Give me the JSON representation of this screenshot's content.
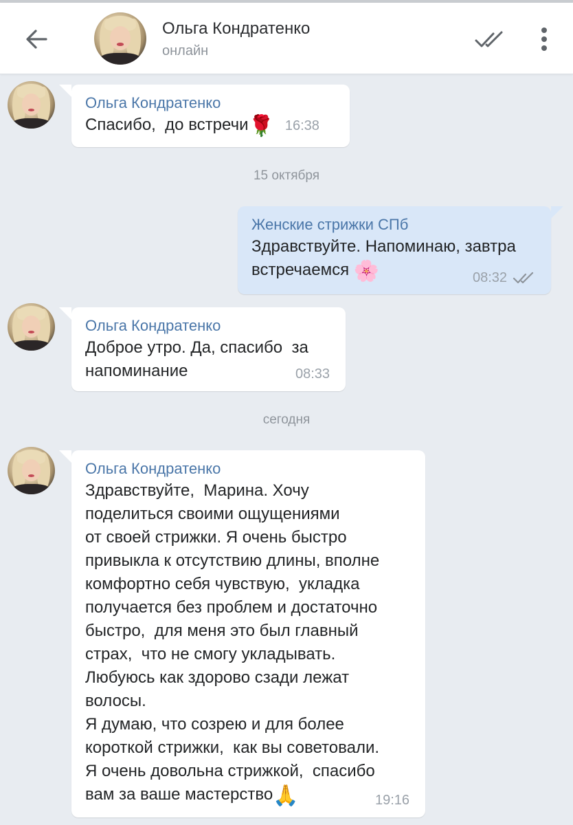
{
  "header": {
    "contact_name": "Ольга Кондратенко",
    "status": "онлайн"
  },
  "colors": {
    "background": "#e8ecf1",
    "incoming_bubble": "#ffffff",
    "outgoing_bubble": "#d9e7f8",
    "sender_name": "#4a76a8",
    "timestamp": "#9aa1a9"
  },
  "messages": [
    {
      "direction": "in",
      "sender": "Ольга Кондратенко",
      "text": "Спасибо,  до встречи",
      "emoji": "🌹",
      "time": "16:38"
    },
    {
      "direction": "out",
      "sender": "Женские стрижки СПб",
      "text": "Здравствуйте. Напоминаю, завтра\nвстречаемся ",
      "emoji": "🌸",
      "time": "08:32",
      "status": "read"
    },
    {
      "direction": "in",
      "sender": "Ольга Кондратенко",
      "text": "Доброе утро. Да, спасибо  за\nнапоминание",
      "time": "08:33"
    },
    {
      "direction": "in",
      "sender": "Ольга Кондратенко",
      "text": "Здравствуйте,  Марина. Хочу\nподелиться своими ощущениями\nот своей стрижки. Я очень быстро\nпривыкла к отсутствию длины, вполне\nкомфортно себя чувствую,  укладка\nполучается без проблем и достаточно\nбыстро,  для меня это был главный\nстрах,  что не смогу укладывать.\nЛюбуюсь как здорово сзади лежат\nволосы.\nЯ думаю, что созрею и для более\nкороткой стрижки,  как вы советовали.\nЯ очень довольна стрижкой,  спасибо\nвам за ваше мастерство",
      "emoji": "🙏",
      "time": "19:16"
    }
  ],
  "date_separators": [
    "15 октября",
    "сегодня"
  ],
  "icons": {
    "back": "arrow-left-icon",
    "read_all": "double-check-icon",
    "menu": "more-vertical-icon"
  }
}
